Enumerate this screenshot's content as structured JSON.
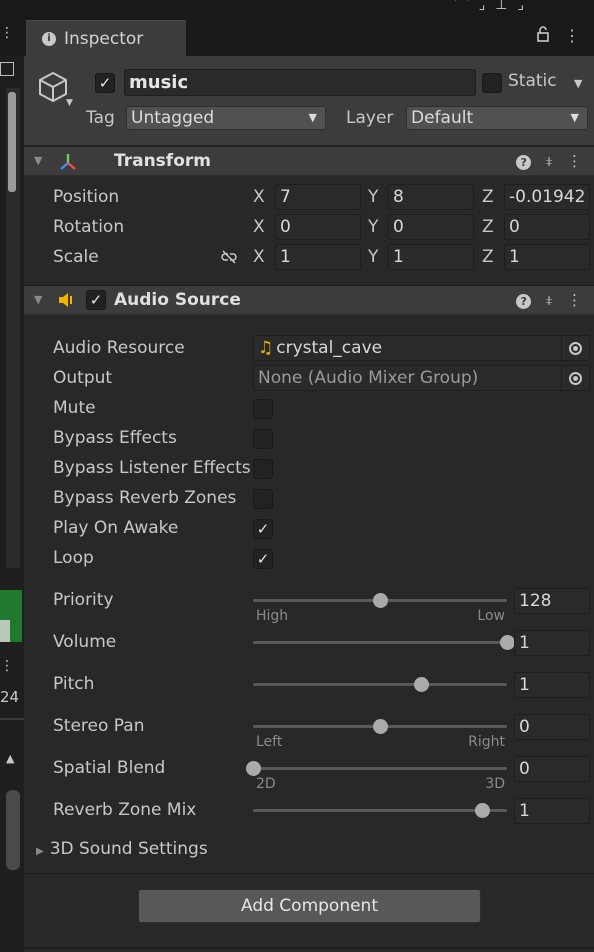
{
  "tab": {
    "label": "Inspector"
  },
  "gameobject": {
    "active": true,
    "name": "music",
    "static_label": "Static",
    "static": false,
    "tag_label": "Tag",
    "tag_value": "Untagged",
    "layer_label": "Layer",
    "layer_value": "Default"
  },
  "transform": {
    "title": "Transform",
    "rows": [
      {
        "label": "Position",
        "x": "7",
        "y": "8",
        "z": "-0.01942"
      },
      {
        "label": "Rotation",
        "x": "0",
        "y": "0",
        "z": "0"
      },
      {
        "label": "Scale",
        "x": "1",
        "y": "1",
        "z": "1"
      }
    ],
    "axes": {
      "x": "X",
      "y": "Y",
      "z": "Z"
    }
  },
  "audio_source": {
    "title": "Audio Source",
    "enabled": true,
    "audio_resource_label": "Audio Resource",
    "audio_resource_value": "crystal_cave",
    "output_label": "Output",
    "output_value": "None (Audio Mixer Group)",
    "toggles": [
      {
        "label": "Mute",
        "checked": false
      },
      {
        "label": "Bypass Effects",
        "checked": false
      },
      {
        "label": "Bypass Listener Effects",
        "checked": false
      },
      {
        "label": "Bypass Reverb Zones",
        "checked": false
      },
      {
        "label": "Play On Awake",
        "checked": true
      },
      {
        "label": "Loop",
        "checked": true
      }
    ],
    "sliders": [
      {
        "label": "Priority",
        "value": "128",
        "fraction": 0.5,
        "min_caption": "High",
        "max_caption": "Low"
      },
      {
        "label": "Volume",
        "value": "1",
        "fraction": 1.0
      },
      {
        "label": "Pitch",
        "value": "1",
        "fraction": 0.66
      },
      {
        "label": "Stereo Pan",
        "value": "0",
        "fraction": 0.5,
        "min_caption": "Left",
        "max_caption": "Right"
      },
      {
        "label": "Spatial Blend",
        "value": "0",
        "fraction": 0.0,
        "min_caption": "2D",
        "max_caption": "3D"
      },
      {
        "label": "Reverb Zone Mix",
        "value": "1",
        "fraction": 0.9
      }
    ],
    "foldout_3d": "3D Sound Settings"
  },
  "add_component_label": "Add Component",
  "left_panel": {
    "number": "24"
  },
  "icons": {
    "info": "info-icon",
    "lock": "lock-icon",
    "menu": "kebab-menu-icon",
    "gameobject": "cube-icon",
    "transform": "transform-axes-icon",
    "audio": "speaker-icon",
    "help": "help-icon",
    "presets": "sliders-icon",
    "constrain": "unlink-icon",
    "picker": "object-picker-icon"
  },
  "colors": {
    "panel_bg": "#282828",
    "header_bg": "#3c3c3c",
    "field_bg": "#2a2a2a",
    "button_bg": "#585858",
    "audio_icon": "#f0b400"
  }
}
